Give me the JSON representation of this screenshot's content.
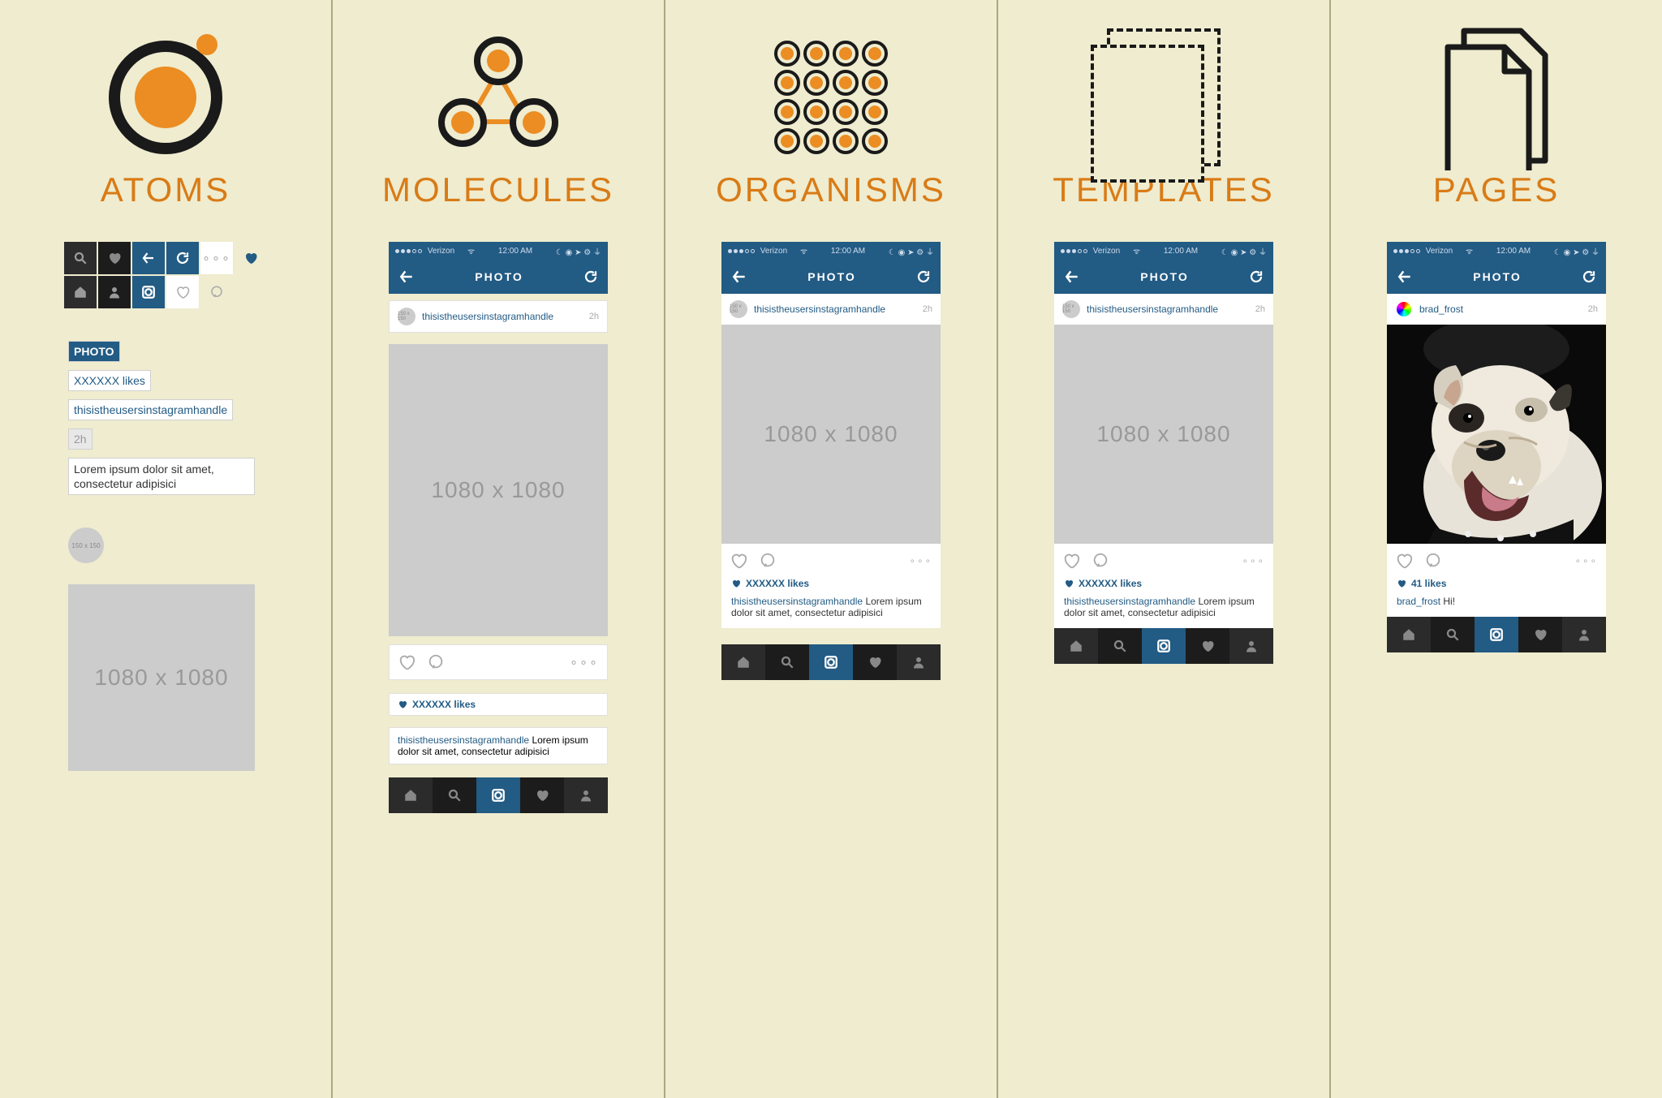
{
  "columns": {
    "atoms": {
      "title": "ATOMS"
    },
    "molecules": {
      "title": "MOLECULES"
    },
    "organisms": {
      "title": "ORGANISMS"
    },
    "templates": {
      "title": "TEMPLATES"
    },
    "pages": {
      "title": "PAGES"
    }
  },
  "atoms": {
    "photo_label": "PHOTO",
    "likes_label": "XXXXXX likes",
    "handle_label": "thisistheusersinstagramhandle",
    "timestamp_label": "2h",
    "caption_label": "Lorem ipsum dolor sit amet, consectetur adipisici",
    "avatar_label": "150 x 150",
    "image_label": "1080 x 1080"
  },
  "phone": {
    "carrier": "Verizon",
    "time": "12:00 AM",
    "nav_title": "PHOTO",
    "placeholder_user": "thisistheusersinstagramhandle",
    "placeholder_avatar": "150 x 150",
    "placeholder_ts": "2h",
    "placeholder_image": "1080 x 1080",
    "placeholder_likes": "XXXXXX likes",
    "placeholder_caption_user": "thisistheusersinstagramhandle",
    "placeholder_caption_text": "Lorem ipsum dolor sit amet, consectetur adipisici",
    "real_user": "brad_frost",
    "real_likes": "41 likes",
    "real_caption_user": "brad_frost",
    "real_caption_text": "Hi!"
  }
}
